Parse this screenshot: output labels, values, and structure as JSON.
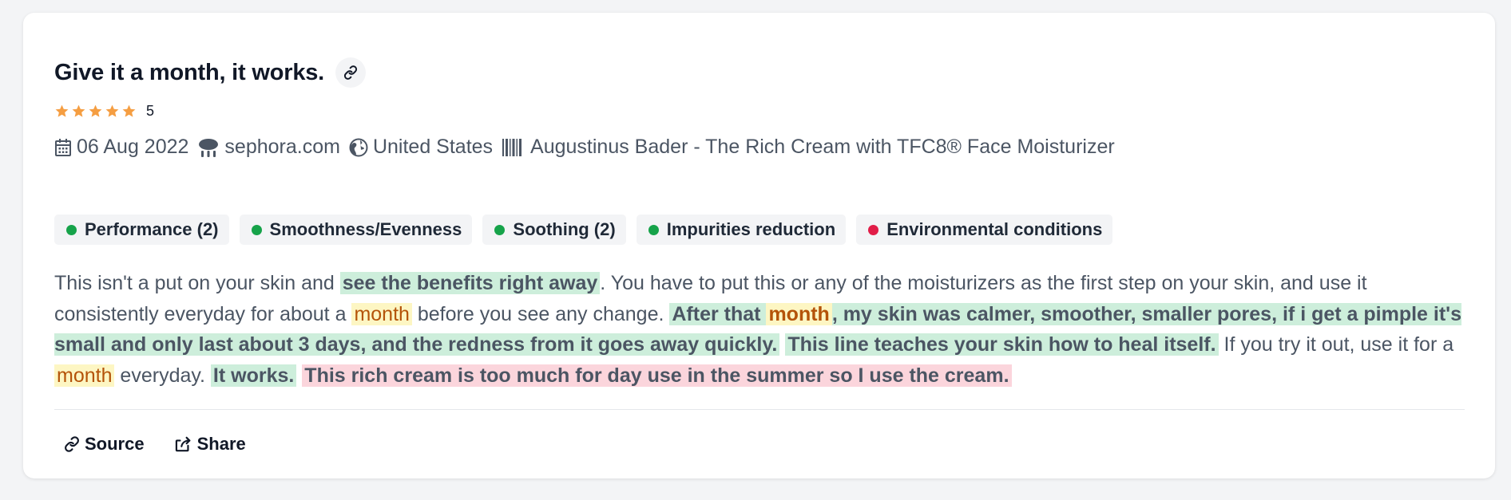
{
  "review": {
    "title": "Give it a month, it works.",
    "rating": 5,
    "rating_label": "5",
    "date": "06 Aug 2022",
    "source_site": "sephora.com",
    "country": "United States",
    "product": "Augustinus Bader - The Rich Cream with TFC8® Face Moisturizer",
    "icons": {
      "link": "link-icon",
      "star": "star-icon",
      "date": "calendar-icon",
      "site": "cloud-icon",
      "country": "globe-icon",
      "product": "barcode-icon"
    }
  },
  "tags": [
    {
      "label": "Performance (2)",
      "sentiment": "positive",
      "color": "#16a34a"
    },
    {
      "label": "Smoothness/Evenness",
      "sentiment": "positive",
      "color": "#16a34a"
    },
    {
      "label": "Soothing (2)",
      "sentiment": "positive",
      "color": "#16a34a"
    },
    {
      "label": "Impurities reduction",
      "sentiment": "positive",
      "color": "#16a34a"
    },
    {
      "label": "Environmental conditions",
      "sentiment": "negative",
      "color": "#e11d48"
    }
  ],
  "body": {
    "s1": "This isn't a put on your skin and ",
    "h1": "see the benefits right away",
    "s2": ". You have to put this or any of the moisturizers as the first step on your skin, and use it consistently everyday for about a ",
    "k1": "month",
    "s3": " before you see any change. ",
    "h2a": "After that ",
    "k2": "month",
    "h2b": ", my skin was calmer, smoother, smaller pores, if i get a pimple it's small and only last about 3 days, and the redness from it goes away quickly.",
    "h3": "This line teaches your skin how to heal itself.",
    "s4": " If you try it out, use it for a ",
    "k3": "month",
    "s5": " everyday. ",
    "h4": "It works.",
    "n1": "This rich cream is too much for day use in the summer so I use the cream."
  },
  "highlight_colors": {
    "positive": "#cdeedb",
    "negative": "#fbd5dc",
    "keyword": "#fdf6c3"
  },
  "actions": {
    "source": "Source",
    "share": "Share"
  }
}
